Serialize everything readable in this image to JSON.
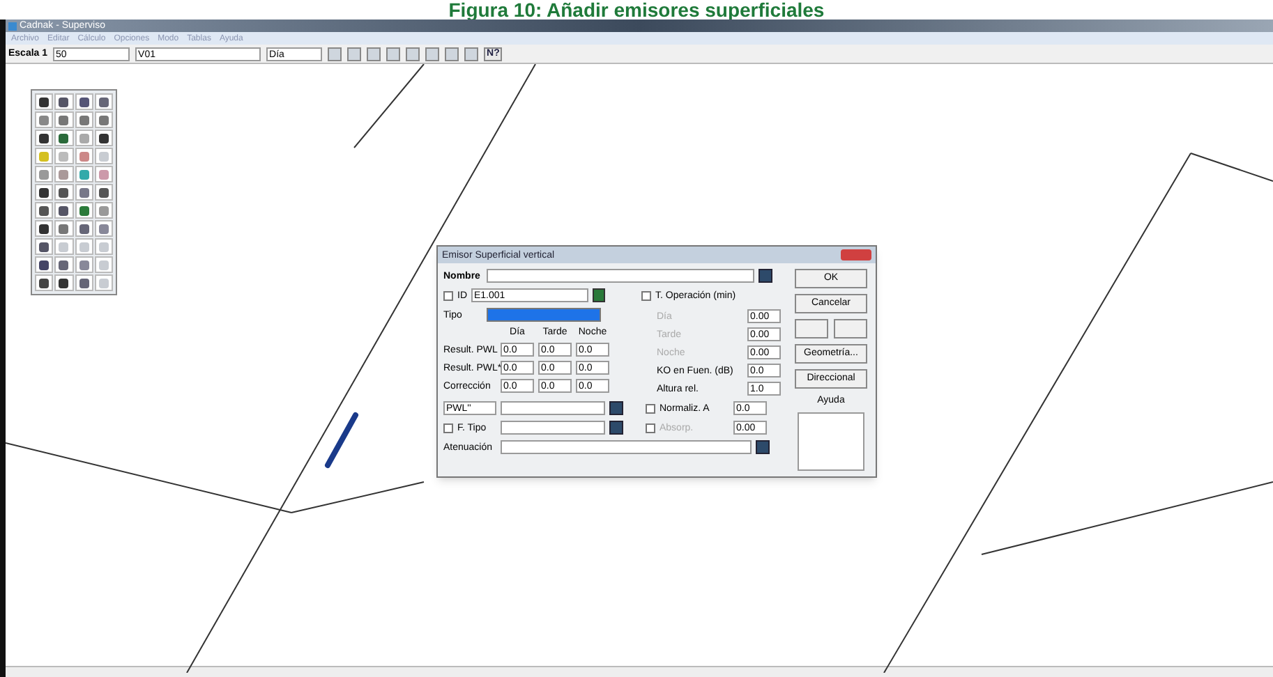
{
  "caption": "Figura 10: Añadir emisores superficiales",
  "window": {
    "title": "Cadnak - Superviso",
    "menu": [
      "Archivo",
      "Editar",
      "Cálculo",
      "Opciones",
      "Modo",
      "Tablas",
      "Ayuda"
    ]
  },
  "toolbar": {
    "scale_label": "Escala 1",
    "scale_value": "50",
    "layer_value": "V01",
    "period_value": "Día",
    "help_label": "N?"
  },
  "dialog": {
    "title": "Emisor Superficial vertical",
    "name_label": "Nombre",
    "id": {
      "label": "ID",
      "checked": false,
      "value": "E1.001"
    },
    "operation": {
      "label": "T. Operación (min)",
      "checked": false
    },
    "type_label": "Tipo",
    "period_headers": [
      "Día",
      "Tarde",
      "Noche"
    ],
    "rows": [
      {
        "label": "Result. PWL",
        "values": [
          "0.0",
          "0.0",
          "0.0"
        ]
      },
      {
        "label": "Result. PWL*",
        "values": [
          "0.0",
          "0.0",
          "0.0"
        ]
      },
      {
        "label": "Corrección",
        "values": [
          "0.0",
          "0.0",
          "0.0"
        ]
      }
    ],
    "op_fields": [
      {
        "label": "Día",
        "value": "0.00"
      },
      {
        "label": "Tarde",
        "value": "0.00"
      },
      {
        "label": "Noche",
        "value": "0.00"
      }
    ],
    "ko": {
      "label": "KO en Fuen. (dB)",
      "value": "0.0"
    },
    "height": {
      "label": "Altura rel.",
      "value": "1.0"
    },
    "pwl_select": "PWL''",
    "ftype": {
      "label": "F. Tipo",
      "checked": false
    },
    "normaliz": {
      "label": "Normaliz. A",
      "checked": false,
      "value": "0.0"
    },
    "absorp": {
      "label": "Absorp.",
      "checked": false,
      "value": "0.00"
    },
    "attenuation_label": "Atenuación",
    "buttons": [
      "OK",
      "Cancelar"
    ],
    "side_buttons": [
      "Geometría...",
      "Direccional"
    ],
    "help": "Ayuda"
  }
}
